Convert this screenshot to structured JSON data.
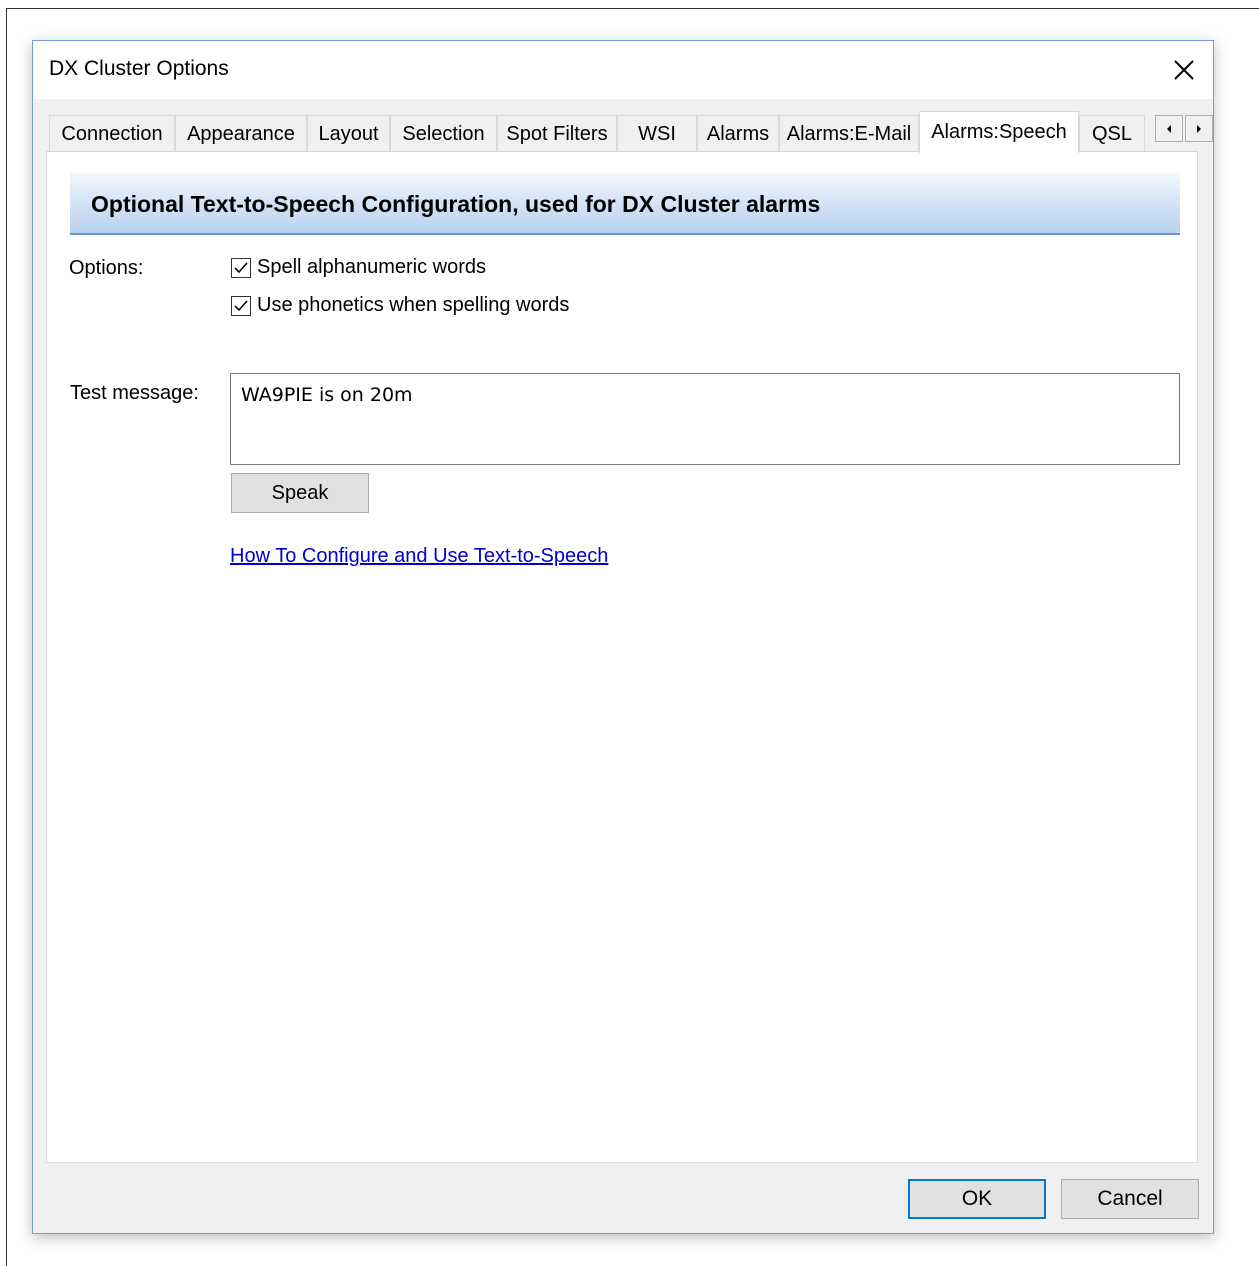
{
  "window": {
    "title": "DX Cluster Options",
    "close_icon": "close-icon"
  },
  "tabs": [
    {
      "label": "Connection"
    },
    {
      "label": "Appearance"
    },
    {
      "label": "Layout"
    },
    {
      "label": "Selection"
    },
    {
      "label": "Spot Filters"
    },
    {
      "label": "WSI"
    },
    {
      "label": "Alarms"
    },
    {
      "label": "Alarms:E-Mail"
    },
    {
      "label": "Alarms:Speech",
      "active": true
    },
    {
      "label": "QSL"
    }
  ],
  "tab_scroll": {
    "left_icon": "arrow-left-icon",
    "right_icon": "arrow-right-icon"
  },
  "page": {
    "banner_title": "Optional Text-to-Speech Configuration, used for DX Cluster alarms",
    "options_label": "Options:",
    "checkboxes": [
      {
        "label": "Spell alphanumeric words",
        "checked": true
      },
      {
        "label": "Use phonetics when spelling words",
        "checked": true
      }
    ],
    "test_message_label": "Test message:",
    "test_message_value": "WA9PIE is on 20m",
    "speak_label": "Speak",
    "help_link": "How To Configure and Use Text-to-Speech"
  },
  "footer": {
    "ok_label": "OK",
    "cancel_label": "Cancel"
  },
  "colors": {
    "accent": "#0078d7",
    "link": "#0000cc",
    "banner_gradient_top": "#f4f8fd",
    "banner_gradient_bottom": "#b9d2ef",
    "banner_border": "#6b93c6"
  }
}
